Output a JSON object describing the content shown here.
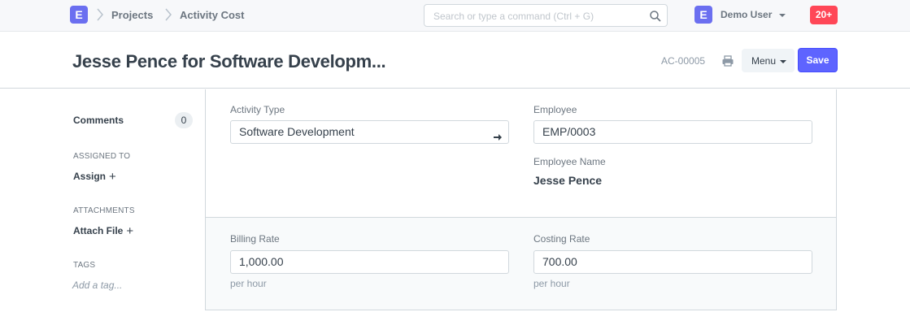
{
  "navbar": {
    "logo_letter": "E",
    "breadcrumbs": [
      "Projects",
      "Activity Cost"
    ],
    "search_placeholder": "Search or type a command (Ctrl + G)",
    "user_initial": "E",
    "user_name": "Demo User",
    "notification_count": "20+"
  },
  "page_head": {
    "title": "Jesse Pence for Software Developm...",
    "doc_id": "AC-00005",
    "menu_label": "Menu",
    "save_label": "Save"
  },
  "sidebar": {
    "comments_label": "Comments",
    "comments_count": "0",
    "assigned_to_label": "ASSIGNED TO",
    "assign_label": "Assign",
    "attachments_label": "ATTACHMENTS",
    "attach_file_label": "Attach File",
    "tags_label": "TAGS",
    "add_tag_label": "Add a tag..."
  },
  "form": {
    "activity_type_label": "Activity Type",
    "activity_type_value": "Software Development",
    "employee_label": "Employee",
    "employee_value": "EMP/0003",
    "employee_name_label": "Employee Name",
    "employee_name_value": "Jesse Pence",
    "billing_rate_label": "Billing Rate",
    "billing_rate_value": "1,000.00",
    "billing_rate_help": "per hour",
    "costing_rate_label": "Costing Rate",
    "costing_rate_value": "700.00",
    "costing_rate_help": "per hour"
  },
  "colors": {
    "brand": "#6b6ff0",
    "primary_button": "#5e64ff",
    "notification": "#ff4757"
  }
}
